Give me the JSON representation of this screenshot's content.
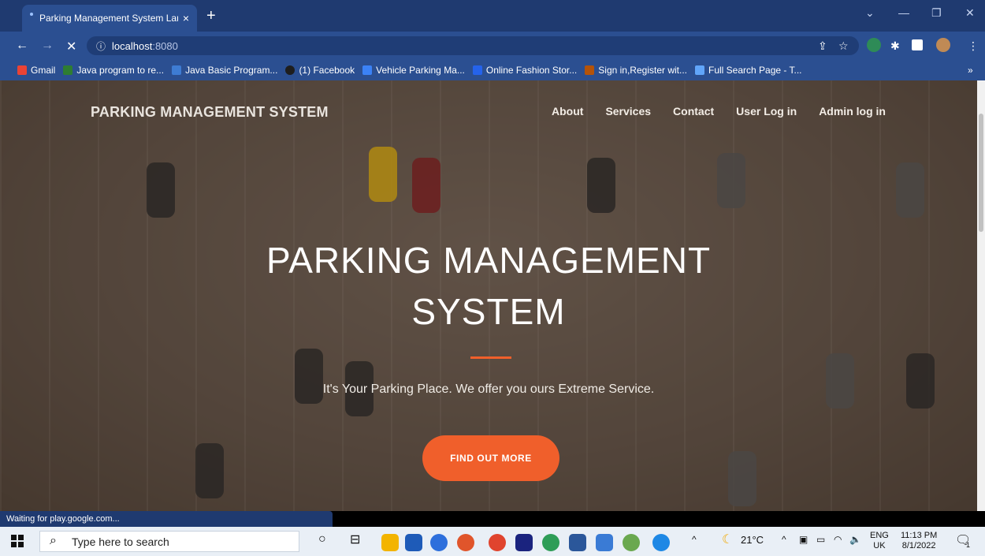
{
  "browser": {
    "tab_title": "Parking Management System Lar",
    "tab_close": "×",
    "new_tab": "+",
    "address_host": "localhost",
    "address_port": ":8080",
    "bookmarks": [
      {
        "label": "Gmail",
        "color": "#ea4335"
      },
      {
        "label": "Java program to re...",
        "color": "#2e7d32"
      },
      {
        "label": "Java Basic Program...",
        "color": "#3e7cd3"
      },
      {
        "label": "(1) Facebook",
        "color": "#1e1e1e"
      },
      {
        "label": "Vehicle Parking Ma...",
        "color": "#3b82f6"
      },
      {
        "label": "Online Fashion Stor...",
        "color": "#2563eb"
      },
      {
        "label": "Sign in,Register wit...",
        "color": "#b45309"
      },
      {
        "label": "Full Search Page - T...",
        "color": "#60a5fa"
      }
    ],
    "bookmarks_more": "»",
    "status_text": "Waiting for play.google.com..."
  },
  "site": {
    "brand": "PARKING MANAGEMENT SYSTEM",
    "nav": [
      "About",
      "Services",
      "Contact",
      "User Log in",
      "Admin log in"
    ],
    "hero_title_line1": "PARKING MANAGEMENT",
    "hero_title_line2": "SYSTEM",
    "subtitle": "It's Your Parking Place. We offer you ours Extreme Service.",
    "cta": "FIND OUT MORE",
    "accent": "#f05f2b"
  },
  "taskbar": {
    "search_placeholder": "Type here to search",
    "weather": "21°C",
    "lang_top": "ENG",
    "lang_bottom": "UK",
    "time": "11:13 PM",
    "date": "8/1/2022",
    "notification_count": "1"
  }
}
